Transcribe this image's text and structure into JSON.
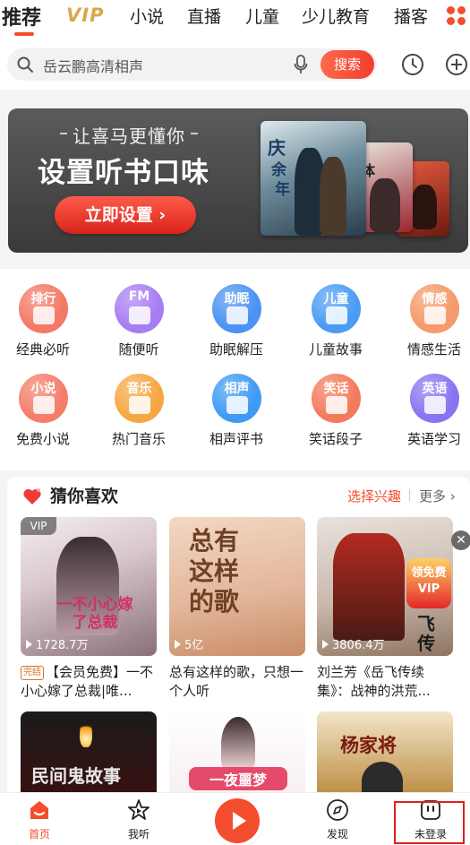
{
  "top_tabs": [
    "推荐",
    "VIP",
    "小说",
    "直播",
    "儿童",
    "少儿教育",
    "播客"
  ],
  "search": {
    "placeholder": "岳云鹏高清相声",
    "button": "搜索"
  },
  "banner": {
    "subtitle": "让喜马更懂你",
    "title": "设置听书口味",
    "button": "立即设置 ›"
  },
  "categories": [
    {
      "icon_text": "排行",
      "label": "经典必听",
      "color": "#f47866",
      "icon": "ranking-icon"
    },
    {
      "icon_text": "FM",
      "label": "随便听",
      "color": "#a77df2",
      "icon": "radio-icon"
    },
    {
      "icon_text": "助眠",
      "label": "助眠解压",
      "color": "#4b92f2",
      "icon": "moon-icon"
    },
    {
      "icon_text": "儿童",
      "label": "儿童故事",
      "color": "#4a9cf3",
      "icon": "kid-face-icon"
    },
    {
      "icon_text": "情感",
      "label": "情感生活",
      "color": "#f59a6a",
      "icon": "heart-pulse-icon"
    },
    {
      "icon_text": "小说",
      "label": "免费小说",
      "color": "#f57d6a",
      "icon": "book-icon"
    },
    {
      "icon_text": "音乐",
      "label": "热门音乐",
      "color": "#f6a743",
      "icon": "music-note-icon"
    },
    {
      "icon_text": "相声",
      "label": "相声评书",
      "color": "#3e9af5",
      "icon": "fan-icon"
    },
    {
      "icon_text": "笑话",
      "label": "笑话段子",
      "color": "#f47a5c",
      "icon": "laugh-face-icon"
    },
    {
      "icon_text": "英语",
      "label": "英语学习",
      "color": "#8a73f2",
      "icon": "en-badge-icon"
    }
  ],
  "recommend": {
    "title": "猜你喜欢",
    "interest_link": "选择兴趣",
    "more_link": "更多 ›",
    "cards": [
      {
        "vip": "VIP",
        "cover_text": "一不小心嫁了总裁",
        "play_count": "1728.7万",
        "badge": "完结",
        "title": "【会员免费】一不小心嫁了总裁|唯..."
      },
      {
        "cover_text": "总有这样的歌",
        "play_count": "5亿",
        "title": "总有这样的歌，只想一个人听"
      },
      {
        "cover_text": "领免费 VIP",
        "cover_side": "飞传",
        "play_count": "3806.4万",
        "title": "刘兰芳《岳飞传续集》：战神的洪荒..."
      }
    ],
    "row2_cover_texts": [
      "民间鬼故事",
      "一夜噩梦",
      "杨家将"
    ]
  },
  "bottom_nav": [
    {
      "label": "首页",
      "icon": "home-icon"
    },
    {
      "label": "我听",
      "icon": "star-icon"
    },
    {
      "label": "发现",
      "icon": "compass-icon"
    },
    {
      "label": "未登录",
      "icon": "user-face-icon"
    }
  ],
  "colors": {
    "accent": "#f44d2e",
    "vip_gold": "#d9a84a"
  }
}
